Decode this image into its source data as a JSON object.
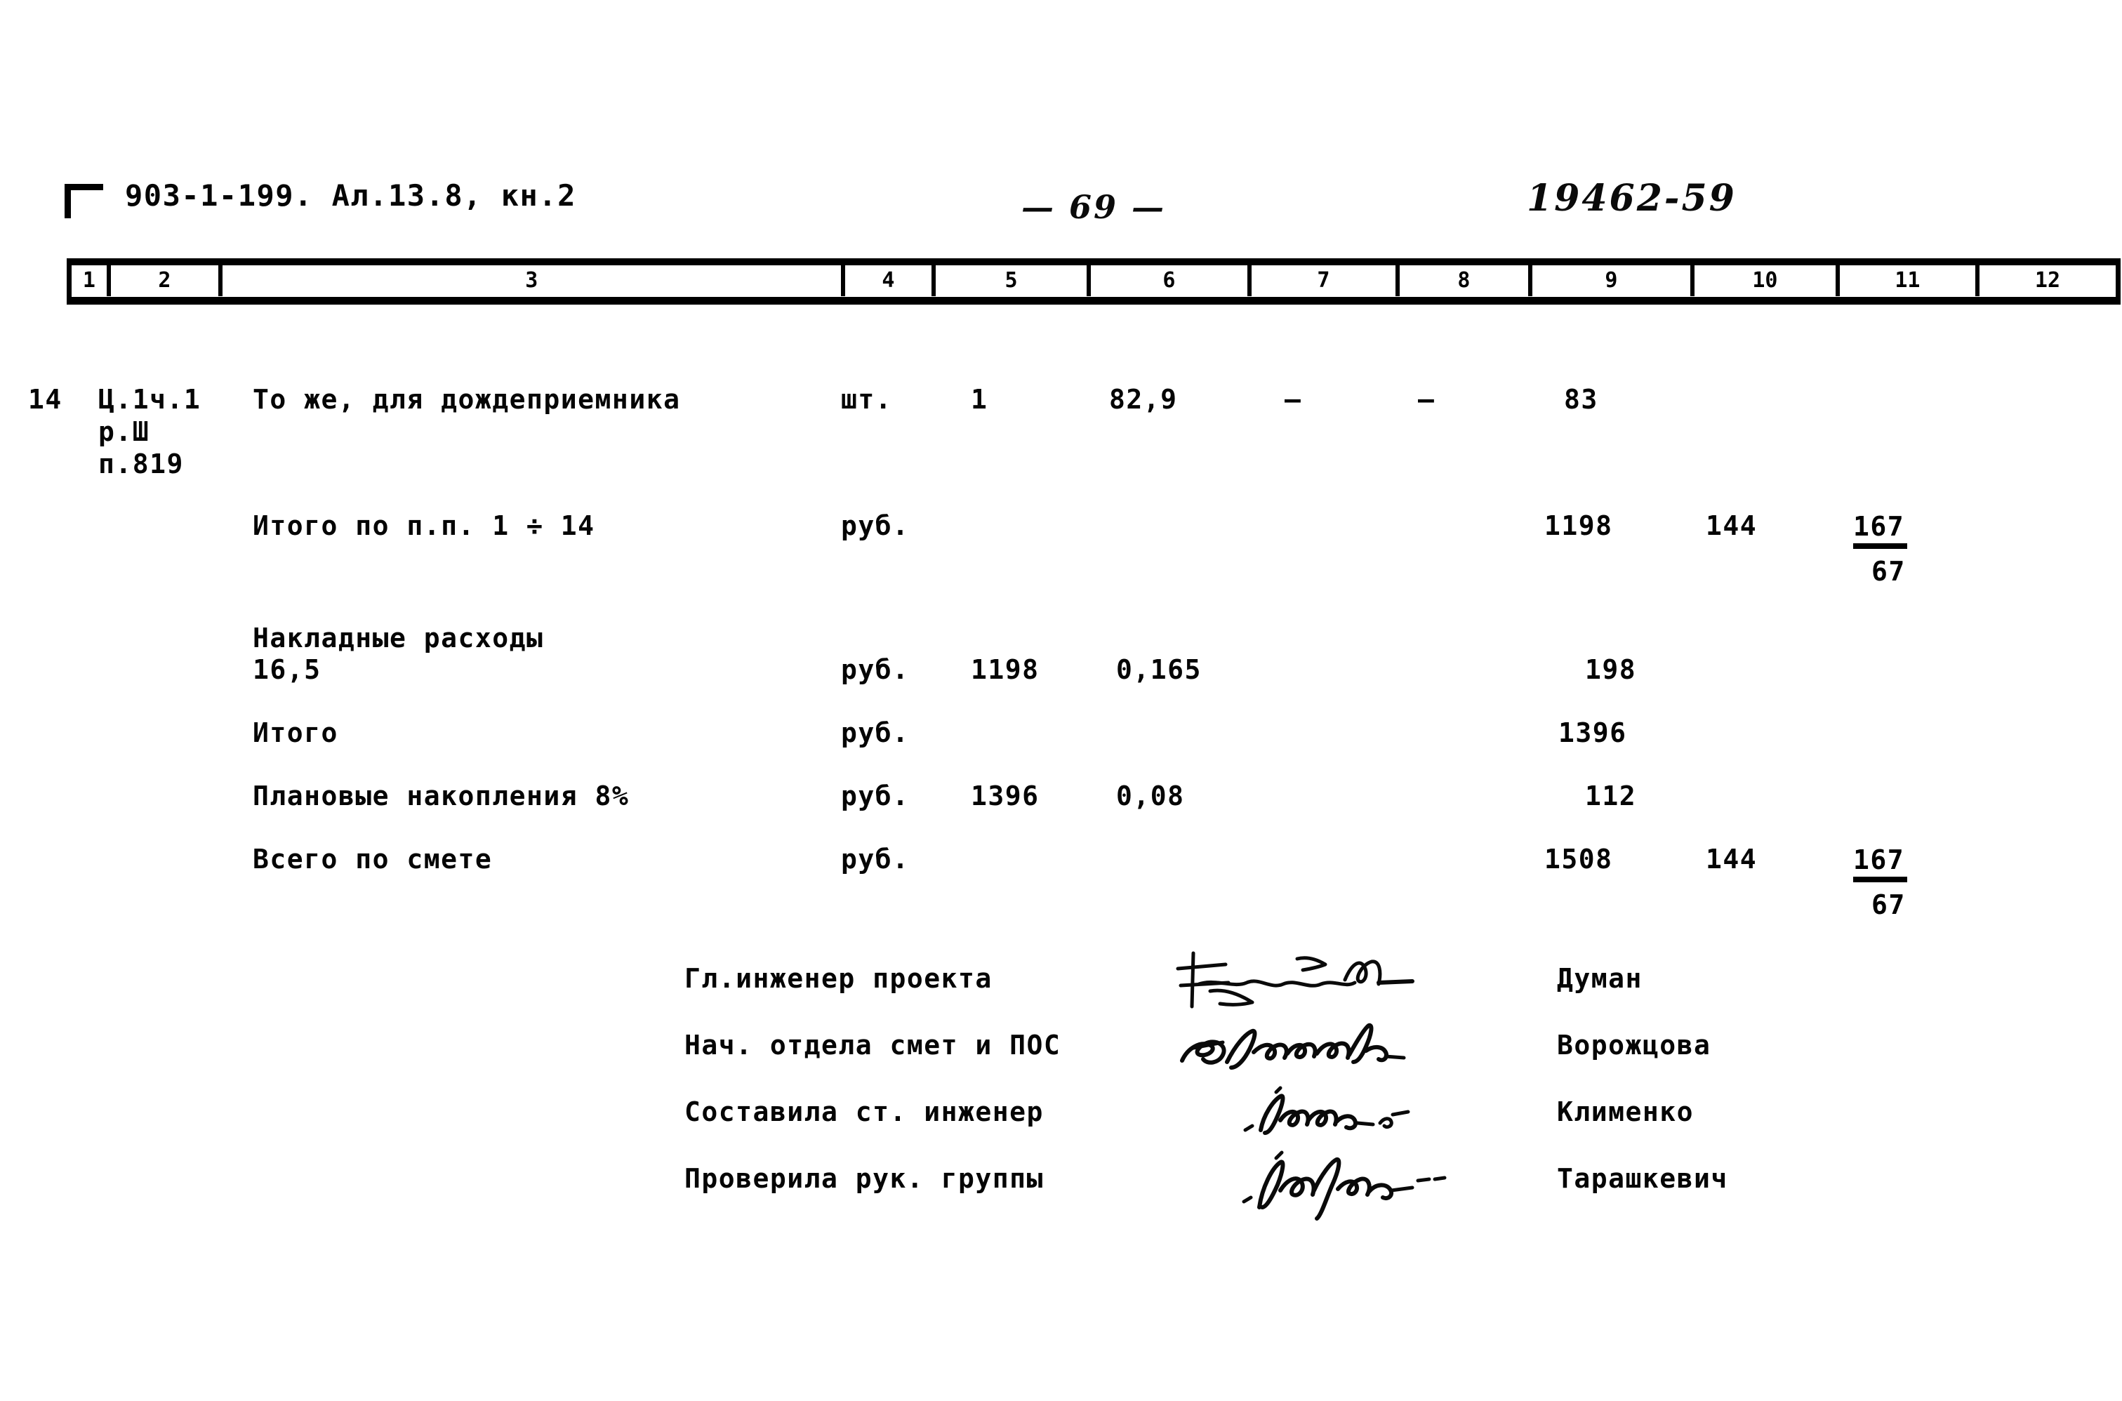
{
  "document": {
    "series_code": "903-1-199. Ал.13.8, кн.2",
    "page_number": "— 69 —",
    "archive_number": "19462-59"
  },
  "column_header": {
    "columns": [
      "1",
      "2",
      "3",
      "4",
      "5",
      "6",
      "7",
      "8",
      "9",
      "10",
      "11",
      "12"
    ]
  },
  "rows": [
    {
      "num": "14",
      "ref_line1": "Ц.1ч.1",
      "ref_line2": "р.Ш",
      "ref_line3": "п.819",
      "description": "То же, для дождеприемника",
      "unit": "шт.",
      "qty": "1",
      "price": "82,9",
      "col7": "—",
      "col8": "—",
      "col9": "83"
    }
  ],
  "totals": [
    {
      "label": "Итого по п.п. 1 ÷ 14",
      "unit": "руб.",
      "base": "",
      "coeff": "",
      "col9": "1198",
      "col10": "144",
      "fraction_num": "167",
      "fraction_den": "67"
    },
    {
      "label_line1": "Накладные расходы",
      "label_line2": "16,5",
      "unit": "руб.",
      "base": "1198",
      "coeff": "0,165",
      "col9": "198",
      "col10": "",
      "fraction_num": "",
      "fraction_den": ""
    },
    {
      "label": "Итого",
      "unit": "руб.",
      "base": "",
      "coeff": "",
      "col9": "1396",
      "col10": "",
      "fraction_num": "",
      "fraction_den": ""
    },
    {
      "label": "Плановые накопления 8%",
      "unit": "руб.",
      "base": "1396",
      "coeff": "0,08",
      "col9": "112",
      "col10": "",
      "fraction_num": "",
      "fraction_den": ""
    },
    {
      "label": "Всего по смете",
      "unit": "руб.",
      "base": "",
      "coeff": "",
      "col9": "1508",
      "col10": "144",
      "fraction_num": "167",
      "fraction_den": "67"
    }
  ],
  "signatures": [
    {
      "role": "Гл.инженер проекта",
      "name": "Думан"
    },
    {
      "role": "Нач. отдела смет и ПОС",
      "name": "Ворожцова"
    },
    {
      "role": "Составила ст. инженер",
      "name": "Клименко"
    },
    {
      "role": "Проверила рук. группы",
      "name": "Тарашкевич"
    }
  ]
}
